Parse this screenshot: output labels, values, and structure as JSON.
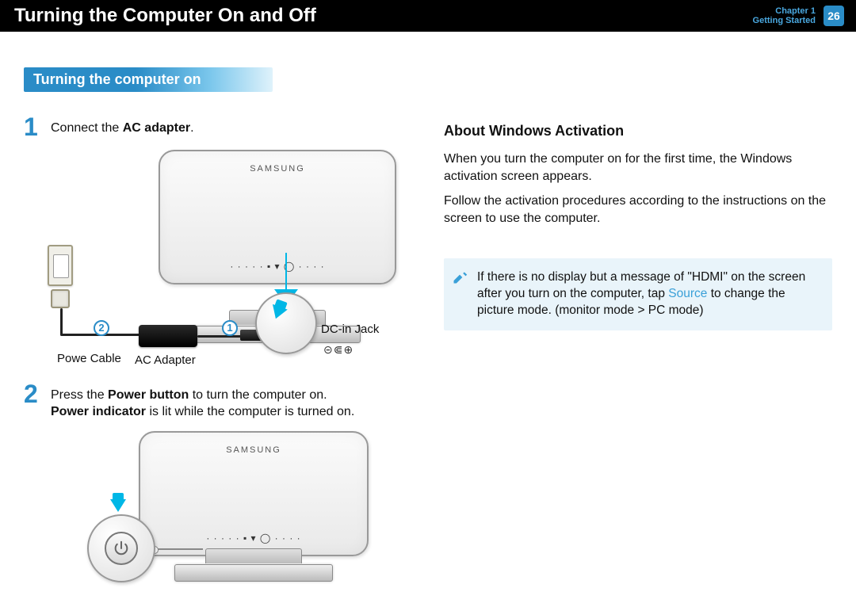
{
  "header": {
    "title": "Turning the Computer On and Off",
    "chapter_line1": "Chapter 1",
    "chapter_line2": "Getting Started",
    "page_number": "26"
  },
  "section_ribbon": "Turning the computer on",
  "steps": {
    "s1": {
      "num": "1",
      "pre": "Connect the ",
      "bold": "AC adapter",
      "post": "."
    },
    "s2": {
      "num": "2",
      "line1_pre": "Press the ",
      "line1_bold": "Power button",
      "line1_post": " to turn the computer on.",
      "line2_bold": "Power indicator",
      "line2_post": " is lit while the computer is turned on."
    }
  },
  "figure1": {
    "brand": "SAMSUNG",
    "speaker": "· · · · · ▪ ▾ ◯ · · · ·",
    "badge1": "1",
    "badge2": "2",
    "label_power_cable": "Powe Cable",
    "label_ac_adapter": "AC Adapter",
    "label_dc_jack": "DC-in Jack",
    "dc_symbol": "⊝⋐⊕"
  },
  "figure2": {
    "brand": "SAMSUNG",
    "speaker": "· · · · · ▪ ▾ ◯ · · · ·"
  },
  "right": {
    "heading": "About Windows Activation",
    "p1": "When you turn the computer on for the first time, the Windows activation screen appears.",
    "p2": "Follow the activation procedures according to the instructions on the screen to use the computer.",
    "note_pre": "If there is no display but a message of \"HDMI\" on the screen after you turn on the computer, tap ",
    "note_source": "Source",
    "note_post": " to change the picture mode. (monitor mode > PC mode)"
  }
}
